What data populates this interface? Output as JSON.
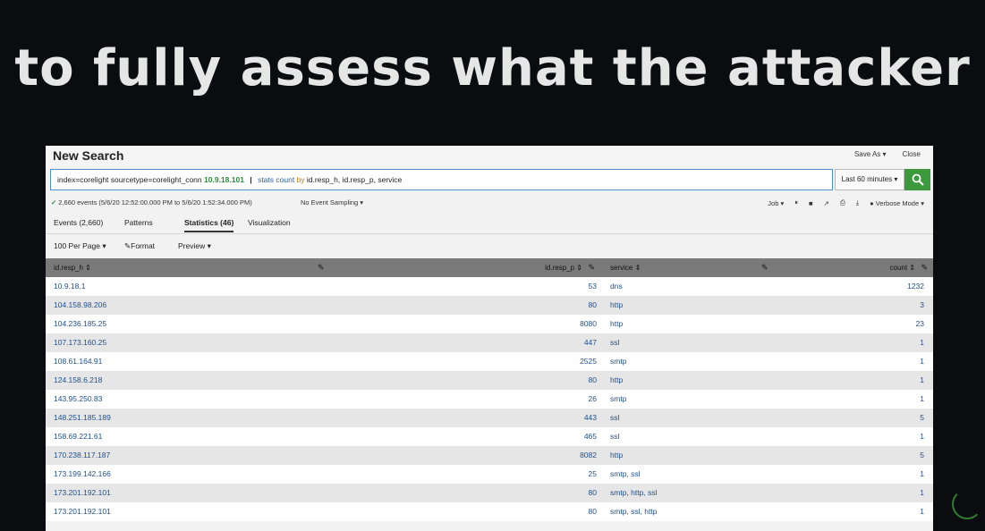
{
  "caption": "to fully assess what the attacker",
  "window": {
    "title": "New Search",
    "save_as": "Save As ▾",
    "close": "Close"
  },
  "search": {
    "tokens": [
      "index=corelight",
      "sourcetype=corelight_conn",
      "10.9.18.101",
      "|",
      "stats",
      "count",
      "by",
      "id.resp_h,",
      "id.resp_p,",
      "service"
    ],
    "time_range": "Last 60 minutes ▾"
  },
  "status": {
    "events_summary": "2,660 events (5/6/20 12:52:00.000 PM to 5/6/20 1:52:34.000 PM)",
    "sampling": "No Event Sampling ▾",
    "job": "Job ▾",
    "mode": "Verbose Mode ▾"
  },
  "tabs": [
    "Events (2,660)",
    "Patterns",
    "Statistics (46)",
    "Visualization"
  ],
  "active_tab": "Statistics (46)",
  "toolbar": {
    "per_page": "100 Per Page ▾",
    "format": "Format",
    "preview": "Preview ▾"
  },
  "columns": [
    "id.resp_h ⇕",
    "id.resp_p ⇕",
    "service ⇕",
    "count ⇕"
  ],
  "rows": [
    [
      "10.9.18.1",
      "53",
      "dns",
      "1232"
    ],
    [
      "104.158.98.206",
      "80",
      "http",
      "3"
    ],
    [
      "104.236.185.25",
      "8080",
      "http",
      "23"
    ],
    [
      "107.173.160.25",
      "447",
      "ssl",
      "1"
    ],
    [
      "108.61.164.91",
      "2525",
      "smtp",
      "1"
    ],
    [
      "124.158.6.218",
      "80",
      "http",
      "1"
    ],
    [
      "143.95.250.83",
      "26",
      "smtp",
      "1"
    ],
    [
      "148.251.185.189",
      "443",
      "ssl",
      "5"
    ],
    [
      "158.69.221.61",
      "465",
      "ssl",
      "1"
    ],
    [
      "170.238.117.187",
      "8082",
      "http",
      "5"
    ],
    [
      "173.199.142.166",
      "25",
      "smtp, ssl",
      "1"
    ],
    [
      "173.201.192.101",
      "80",
      "smtp, http, ssl",
      "1"
    ],
    [
      "173.201.192.101",
      "80",
      "smtp, ssl, http",
      "1"
    ]
  ],
  "colors": {
    "accent": "#3c9a3c",
    "link": "#1f4f8e",
    "header": "#7a7a7a"
  }
}
